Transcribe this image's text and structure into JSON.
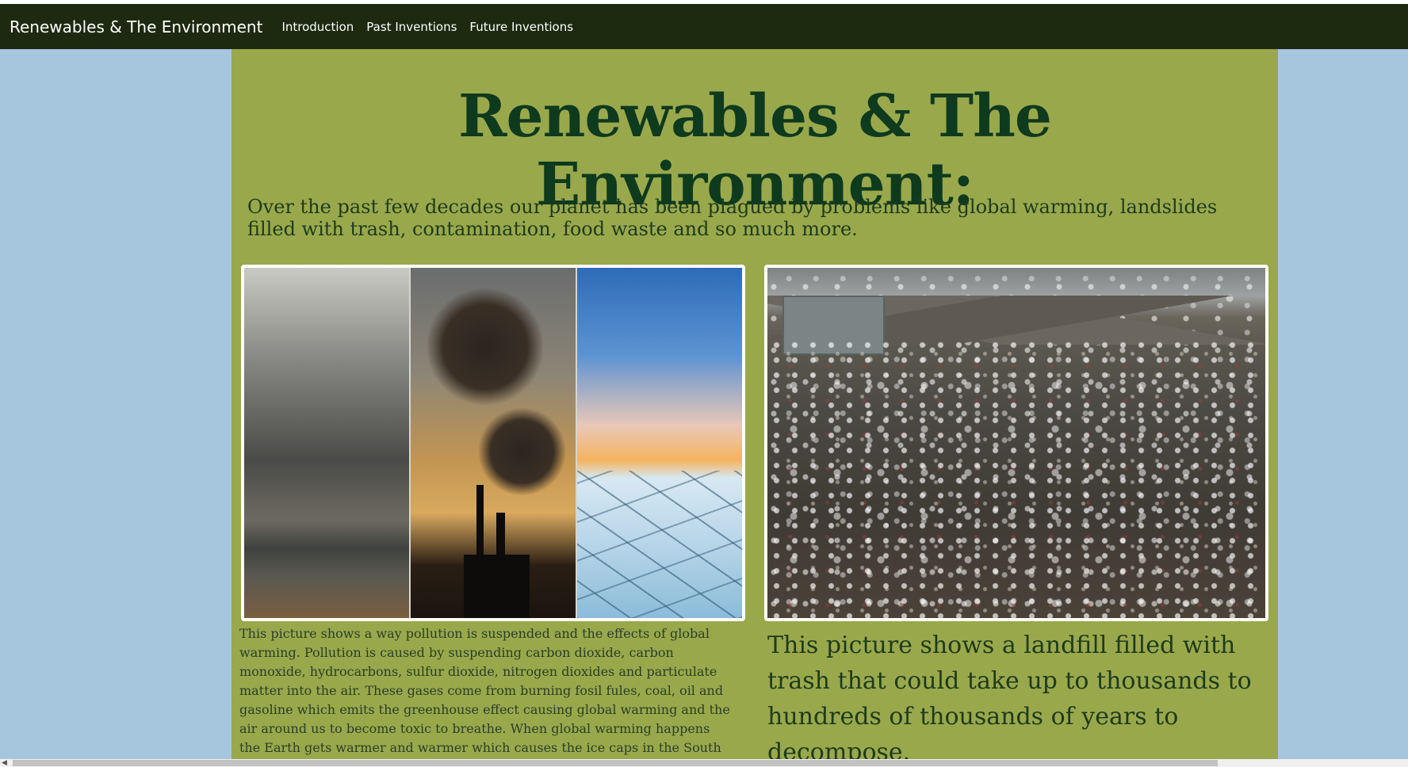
{
  "navbar": {
    "brand": "Renewables & The Environment",
    "links": [
      "Introduction",
      "Past Inventions",
      "Future Inventions"
    ]
  },
  "main": {
    "title": "Renewables & The Environment:",
    "intro": "Over the past few decades our planet has been plagued by problems like global warming, landslides filled with trash, contamination, food waste and so much more.",
    "caption_pollution": "This picture shows a way pollution is suspended and the effects of global warming. Pollution is caused by suspending carbon dioxide, carbon monoxide, hydrocarbons, sulfur dioxide, nitrogen dioxides and particulate matter into the air. These gases come from burning fosil fules, coal, oil and gasoline which emits the greenhouse effect causing global warming and the air around us to become toxic to breathe. When global warming happens the Earth gets warmer and warmer which causes the ice caps in the South and",
    "caption_landfill": "This picture shows a landfill filled with trash that could take up to thousands to hundreds of thousands of years to decompose."
  },
  "colors": {
    "page_background": "#a5c6dc",
    "navbar_background": "#1e2a10",
    "content_background": "#9aa84c",
    "title_color": "#0e3a1e"
  },
  "icons": {
    "scroll_left": "scroll-left-arrow-icon"
  }
}
